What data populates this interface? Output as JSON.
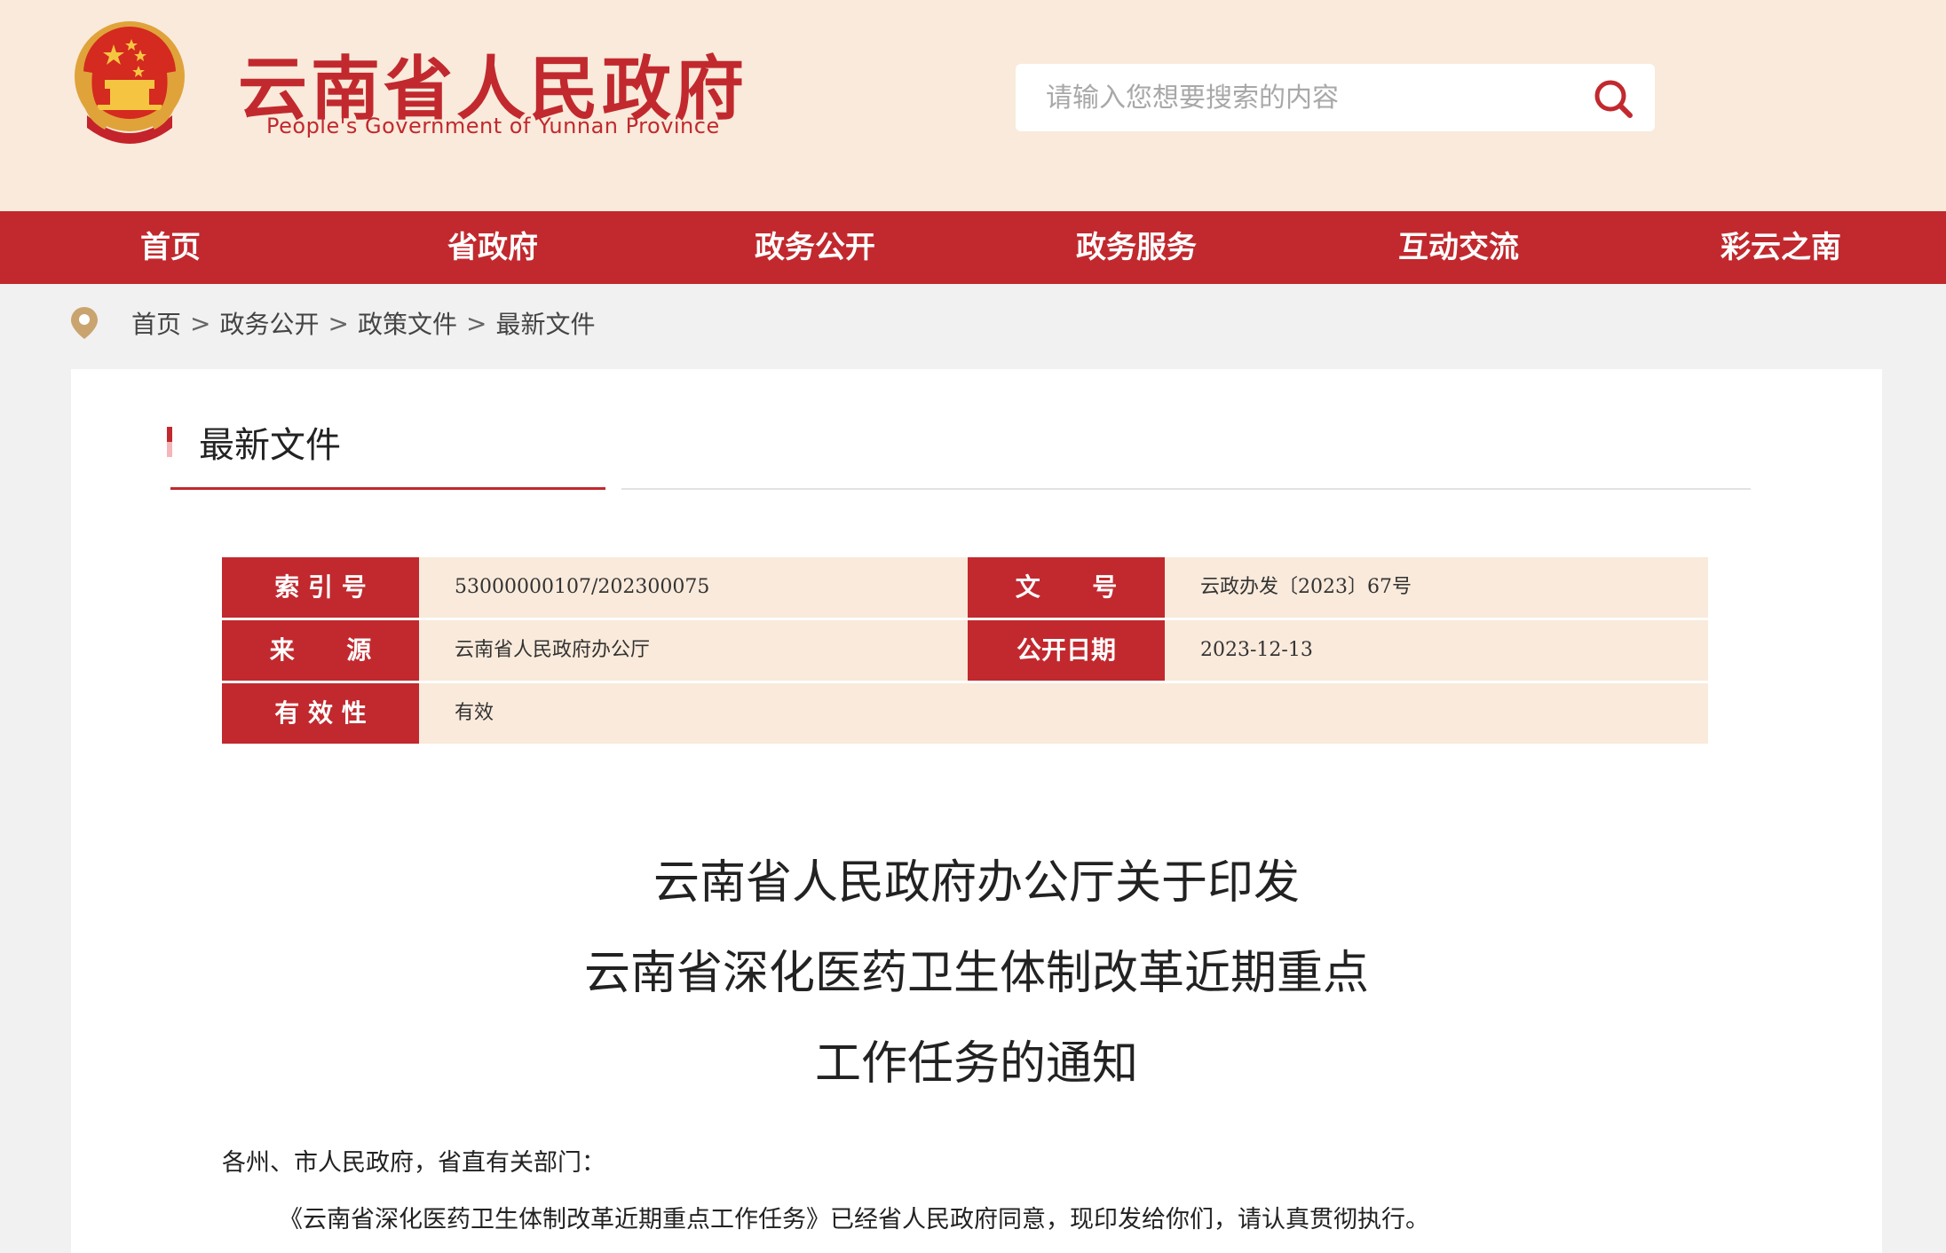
{
  "header": {
    "logo_cn": "云南省人民政府",
    "logo_en": "People's Government of Yunnan Province",
    "top_links": [
      "",
      "",
      "",
      "",
      ""
    ],
    "search_placeholder": "请输入您想要搜索的内容"
  },
  "nav": {
    "items": [
      "首页",
      "省政府",
      "政务公开",
      "政务服务",
      "互动交流",
      "彩云之南"
    ]
  },
  "breadcrumb": [
    "首页",
    "政务公开",
    "政策文件",
    "最新文件"
  ],
  "section": {
    "title": "最新文件"
  },
  "meta": {
    "index_label": "索 引 号",
    "index_value": "53000000107/202300075",
    "doc_no_label": "文      号",
    "doc_no_value": "云政办发〔2023〕67号",
    "source_label": "来      源",
    "source_value": "云南省人民政府办公厅",
    "date_label": "公开日期",
    "date_value": "2023-12-13",
    "validity_label": "有 效 性",
    "validity_value": "有效"
  },
  "document": {
    "title_lines": [
      "云南省人民政府办公厅关于印发",
      "云南省深化医药卫生体制改革近期重点",
      "工作任务的通知"
    ],
    "salutation": "各州、市人民政府，省直有关部门：",
    "paragraph_1": "《云南省深化医药卫生体制改革近期重点工作任务》已经省人民政府同意，现印发给你们，请认真贯彻执行。"
  },
  "colors": {
    "brand_red": "#c1292e",
    "header_bg": "#f9eadb"
  }
}
